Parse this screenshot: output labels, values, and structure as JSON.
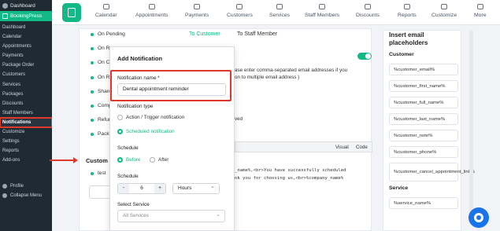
{
  "sidebar": {
    "top_label": "Dashboard",
    "brand_label": "BookingPress",
    "items": [
      {
        "label": "Dashboard"
      },
      {
        "label": "Calendar"
      },
      {
        "label": "Appointments"
      },
      {
        "label": "Payments"
      },
      {
        "label": "Package Order"
      },
      {
        "label": "Customers"
      },
      {
        "label": "Services"
      },
      {
        "label": "Packages"
      },
      {
        "label": "Discounts"
      },
      {
        "label": "Staff Members"
      },
      {
        "label": "Notifications"
      },
      {
        "label": "Customize"
      },
      {
        "label": "Settings"
      },
      {
        "label": "Reports"
      },
      {
        "label": "Add-ons"
      }
    ],
    "profile_label": "Profile",
    "collapse_label": "Collapse Menu"
  },
  "topnav": {
    "items": [
      {
        "label": "Calendar",
        "icon": "calendar-icon"
      },
      {
        "label": "Appointments",
        "icon": "appointments-icon"
      },
      {
        "label": "Payments",
        "icon": "payments-icon"
      },
      {
        "label": "Customers",
        "icon": "customers-icon"
      },
      {
        "label": "Services",
        "icon": "services-icon"
      },
      {
        "label": "Staff Members",
        "icon": "staff-icon"
      },
      {
        "label": "Discounts",
        "icon": "discounts-icon"
      },
      {
        "label": "Reports",
        "icon": "reports-icon"
      },
      {
        "label": "Customize",
        "icon": "customize-icon"
      },
      {
        "label": "More",
        "icon": "more-icon"
      }
    ]
  },
  "main": {
    "conditions": [
      "On Pending",
      "On Re",
      "On Co",
      "On Re",
      "Share",
      "Comp",
      "Refun",
      "Pack"
    ],
    "custom_label": "Custom",
    "test_label": "test",
    "tab_customer": "To Customer",
    "tab_staff": "To Staff Member",
    "hint_line1": "ase enter comma-separated email addresses if you",
    "hint_line2": "on to multiple email address )",
    "subject_fragment": "ved",
    "editor_visual": "Visual",
    "editor_code": "Code",
    "body_line1": "_name%,<br>You have successfully scheduled",
    "body_line2": "nk you for choosing us,<br>%company_name%"
  },
  "placeholders": {
    "title": "Insert email placeholders",
    "customer_section": "Customer",
    "customer_items": [
      "%customer_email%",
      "%customer_first_name%",
      "%customer_full_name%",
      "%customer_last_name%",
      "%customer_note%",
      "%customer_phone%",
      "%customer_cancel_appointment_link%"
    ],
    "service_section": "Service",
    "service_items": [
      "%service_name%"
    ]
  },
  "modal": {
    "title": "Add Notification",
    "name_label": "Notification name *",
    "name_value": "Dental appointment reminder",
    "type_label": "Notification type",
    "type_option1": "Action / Trigger notification",
    "type_option2": "Scheduled notification",
    "schedule_label": "Schedule",
    "before_label": "Before",
    "after_label": "After",
    "schedule_label2": "Schedule",
    "stepper_minus": "-",
    "stepper_value": "6",
    "stepper_plus": "+",
    "unit_value": "Hours",
    "service_label": "Select Service",
    "service_placeholder": "All Services"
  },
  "colors": {
    "accent": "#12b886",
    "highlight": "#e0392b",
    "sidebar_bg": "#1f2a33"
  }
}
